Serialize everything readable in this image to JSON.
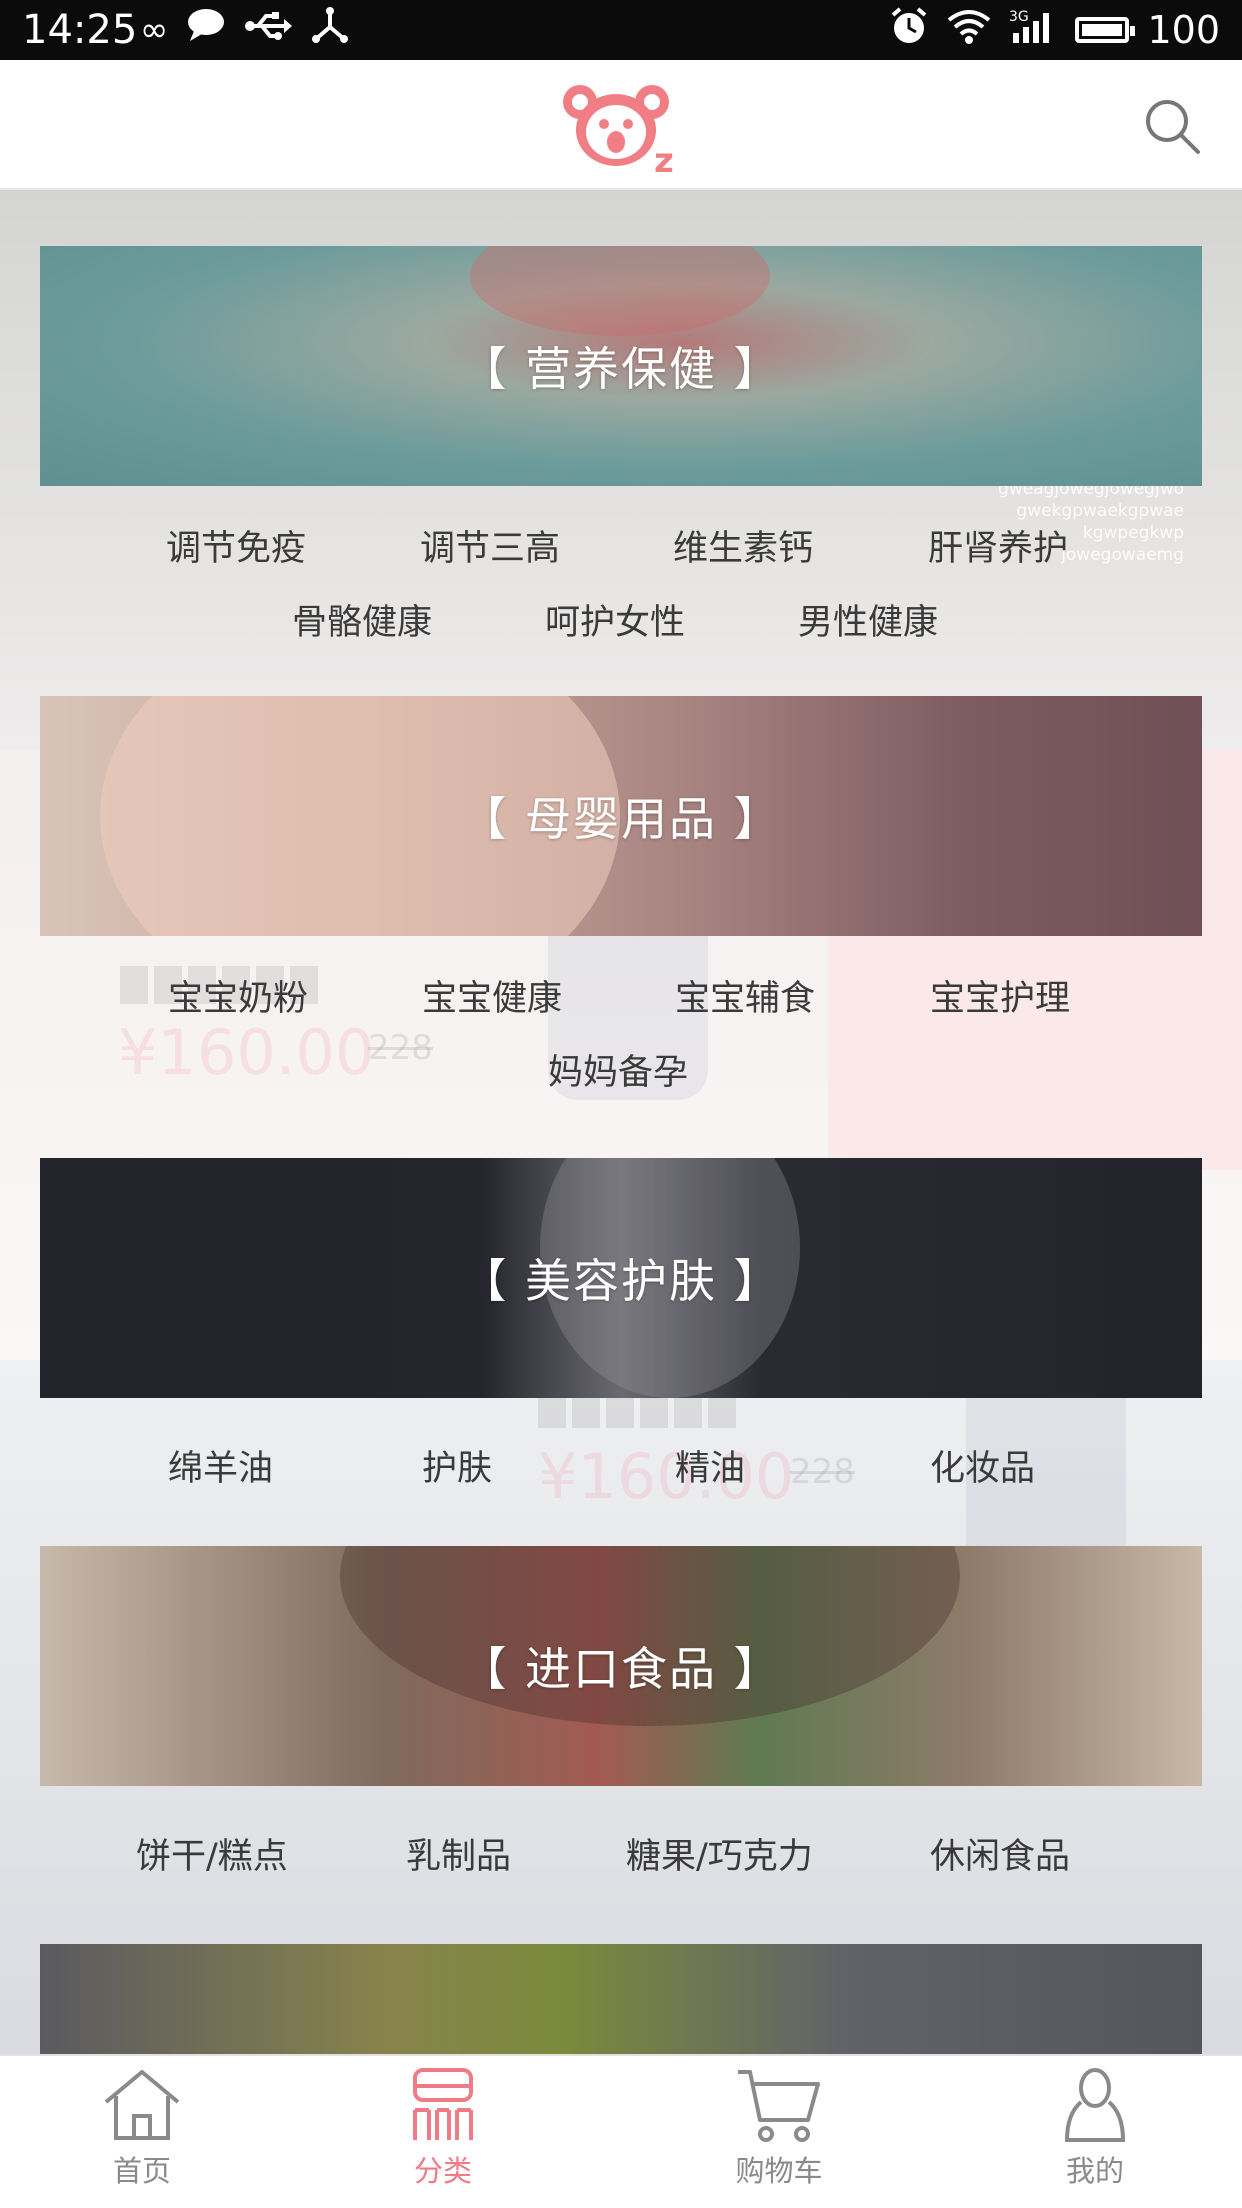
{
  "status_bar": {
    "time": "14:25",
    "battery_level": "100",
    "icons": [
      "infinity-icon",
      "chat-icon",
      "usb-icon",
      "share-icon",
      "alarm-icon",
      "wifi-icon",
      "signal-3g-icon",
      "battery-icon"
    ],
    "signal_label": "3G"
  },
  "header": {
    "logo_icon": "koala-logo",
    "logo_letter": "z",
    "search_icon": "search-icon",
    "accent_color": "#f07e84"
  },
  "background_ghost": {
    "price1": "¥160.00",
    "old1": "228",
    "price2": "¥160.00",
    "old2": "228",
    "timer1": [
      "0",
      "3",
      "2",
      "0",
      "3",
      "2"
    ],
    "timer2": [
      "0",
      "3",
      "2",
      "0",
      "3",
      "2"
    ],
    "corner_text": [
      "gweagjowegjowegjwo",
      "gwekgpwaekgpwae",
      "kgwpegkwp",
      "jowegowaemg"
    ]
  },
  "categories": [
    {
      "title": "【 营养保健 】",
      "items": [
        "调节免疫",
        "调节三高",
        "维生素钙",
        "肝肾养护",
        "骨骼健康",
        "呵护女性",
        "男性健康"
      ]
    },
    {
      "title": "【 母婴用品 】",
      "items": [
        "宝宝奶粉",
        "宝宝健康",
        "宝宝辅食",
        "宝宝护理",
        "妈妈备孕"
      ]
    },
    {
      "title": "【 美容护肤 】",
      "items": [
        "绵羊油",
        "护肤",
        "精油",
        "化妆品"
      ]
    },
    {
      "title": "【 进口食品 】",
      "items": [
        "饼干/糕点",
        "乳制品",
        "糖果/巧克力",
        "休闲食品"
      ]
    }
  ],
  "tabbar": {
    "tabs": [
      {
        "label": "首页",
        "icon": "home-icon",
        "active": false
      },
      {
        "label": "分类",
        "icon": "category-icon",
        "active": true
      },
      {
        "label": "购物车",
        "icon": "cart-icon",
        "active": false
      },
      {
        "label": "我的",
        "icon": "profile-icon",
        "active": false
      }
    ],
    "active_color": "#ef7b86",
    "inactive_color": "#8a8a8a"
  }
}
